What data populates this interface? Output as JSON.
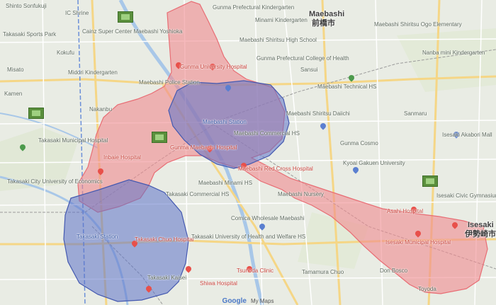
{
  "footer": {
    "brand": "Google",
    "product": "My Maps"
  },
  "colors": {
    "red_zone": "#f08a8f",
    "blue_zone": "#5d73c9",
    "water": "#a8c7e8"
  },
  "labels": [
    {
      "id": "shinto-sonfukuji",
      "text": "Shinto Sonfukuji",
      "style": ""
    },
    {
      "id": "ic-shrine",
      "text": "IC Shrine",
      "style": ""
    },
    {
      "id": "maebashi",
      "text": "Maebashi",
      "style": "big"
    },
    {
      "id": "maebashi-jp",
      "text": "前橋市",
      "style": "big"
    },
    {
      "id": "ogo-elem",
      "text": "Maebashi Shiritsu Ogo Elementary",
      "style": ""
    },
    {
      "id": "minami",
      "text": "Minami Kindergarten",
      "style": ""
    },
    {
      "id": "nanba-mini",
      "text": "Nanba mini Kindergarten",
      "style": ""
    },
    {
      "id": "takasaki-sports",
      "text": "Takasaki Sports Park",
      "style": ""
    },
    {
      "id": "central-super",
      "text": "Cainz Super Center Maebashi Yoshioka",
      "style": ""
    },
    {
      "id": "gunma-pref",
      "text": "Gunma Prefectural Kindergarten",
      "style": ""
    },
    {
      "id": "maebashi-shiritsu-hs",
      "text": "Maebashi Shiritsu High School",
      "style": ""
    },
    {
      "id": "kokufu",
      "text": "Kokufu",
      "style": ""
    },
    {
      "id": "gunma-univ",
      "text": "Gunma University Hospital",
      "style": "red"
    },
    {
      "id": "misato",
      "text": "Misato",
      "style": ""
    },
    {
      "id": "kamen",
      "text": "Kamen",
      "style": ""
    },
    {
      "id": "midori",
      "text": "Midori Kindergarten",
      "style": ""
    },
    {
      "id": "gunma-pref-college",
      "text": "Gunma Prefectural College of Health",
      "style": ""
    },
    {
      "id": "maebashi-police",
      "text": "Maebashi Police Station",
      "style": ""
    },
    {
      "id": "maebashi-tech",
      "text": "Maebashi Technical HS",
      "style": ""
    },
    {
      "id": "maebashi-shiritsu-daiichi",
      "text": "Maebashi Shiritsu Daiichi",
      "style": ""
    },
    {
      "id": "nakanbu",
      "text": "Nakanbu",
      "style": ""
    },
    {
      "id": "maebashi-commercial",
      "text": "Maebashi Commercial HS",
      "style": ""
    },
    {
      "id": "gunma-maebashi-hosp",
      "text": "Gunma Maebashi Hospital",
      "style": "red"
    },
    {
      "id": "maebashi-red-cross",
      "text": "Maebashi Red Cross Hospital",
      "style": "red"
    },
    {
      "id": "inba-hosp",
      "text": "Inbaie Hospital",
      "style": "red"
    },
    {
      "id": "takasaki-muni",
      "text": "Takasaki Municipal Hospital",
      "style": ""
    },
    {
      "id": "takasaki-city-univ",
      "text": "Takasaki City University of Economics",
      "style": ""
    },
    {
      "id": "takasaki-commercial",
      "text": "Takasaki Commercial HS",
      "style": ""
    },
    {
      "id": "maebashi-minami",
      "text": "Maebashi Minami HS",
      "style": ""
    },
    {
      "id": "kyoai",
      "text": "Kyoai Gakuen University",
      "style": ""
    },
    {
      "id": "maebashi-nursery",
      "text": "Maebashi Nursery",
      "style": ""
    },
    {
      "id": "asahi",
      "text": "Asahi Hospital",
      "style": "red"
    },
    {
      "id": "takasaki-station",
      "text": "Takasaki Station",
      "style": "blue"
    },
    {
      "id": "takasaki-chuo",
      "text": "Takasaki Chuo Hospital",
      "style": "red"
    },
    {
      "id": "comica",
      "text": "Comica Wholesale Maebashi",
      "style": ""
    },
    {
      "id": "takasaki-univ-welfare",
      "text": "Takasaki University of Health and Welfare HS",
      "style": ""
    },
    {
      "id": "tsunoda",
      "text": "Tsunoda Clinic",
      "style": "red"
    },
    {
      "id": "shiwa",
      "text": "Shiwa Hospital",
      "style": "red"
    },
    {
      "id": "isesaki-muni",
      "text": "Isesaki Municipal Hospital",
      "style": "red"
    },
    {
      "id": "isesaki",
      "text": "Isesaki",
      "style": "big"
    },
    {
      "id": "isesaki-jp",
      "text": "伊勢崎市",
      "style": "big"
    },
    {
      "id": "don-bosco",
      "text": "Don Bosco",
      "style": ""
    },
    {
      "id": "takasaki-kaisei",
      "text": "Takasaki Kaisei",
      "style": ""
    },
    {
      "id": "tamamura",
      "text": "Tamamura Chuo",
      "style": ""
    },
    {
      "id": "isesaki-akabori",
      "text": "Isesaki Akabori Mall",
      "style": ""
    },
    {
      "id": "isesaki-civic",
      "text": "Isesaki Civic Gymnasium",
      "style": ""
    },
    {
      "id": "sanmaru",
      "text": "Sanmaru",
      "style": ""
    },
    {
      "id": "gunma-cosmo",
      "text": "Gunma Cosmo",
      "style": ""
    },
    {
      "id": "sansui",
      "text": "Sansui",
      "style": ""
    },
    {
      "id": "toyoda",
      "text": "Toyoda",
      "style": ""
    },
    {
      "id": "maebashi-station",
      "text": "Maebashi Station",
      "style": "blue"
    }
  ]
}
